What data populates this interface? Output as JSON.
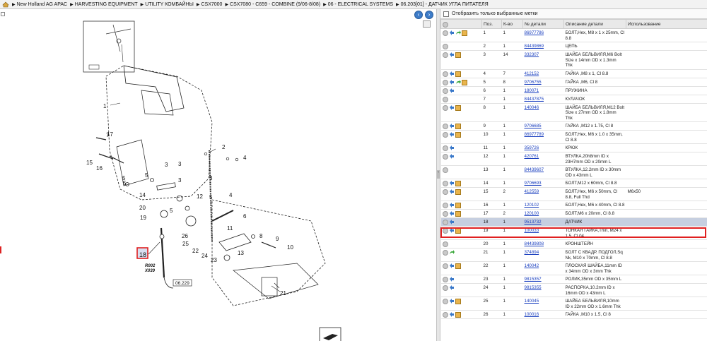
{
  "breadcrumb": [
    "New Holland AG APAC",
    "HARVESTING EQUIPMENT",
    "UTILITY КОМБАЙНЫ",
    "CSX7000",
    "CSX7080 - C659 - COMBINE (9/06-8/08)",
    "06 - ELECTRICAL SYSTEMS",
    "06.203[01] - ДАТЧИК УГЛА ПИТАТЕЛЯ"
  ],
  "filter": {
    "label": "Отобразить только выбранные метки"
  },
  "table": {
    "headers": [
      "Поз.",
      "К-во",
      "№ детали",
      "Описание детали",
      "Использование"
    ],
    "rows": [
      {
        "pos": "1",
        "qty": "1",
        "part": "86977786",
        "desc": "БОЛТ,Hex, M8 x 1 x 25mm, Cl 8.8",
        "usage": "",
        "icons": [
          "circle",
          "blue",
          "green",
          "box"
        ]
      },
      {
        "pos": "2",
        "qty": "1",
        "part": "84439869",
        "desc": "ЦЕПЬ",
        "usage": "",
        "icons": [
          "circle"
        ]
      },
      {
        "pos": "3",
        "qty": "14",
        "part": "332307",
        "desc": "ШАЙБА БЕЛЬВИЛЯ,M6 Bolt Size x 14mm OD x 1.3mm Thk",
        "usage": "",
        "icons": [
          "circle",
          "blue",
          "box"
        ]
      },
      {
        "pos": "4",
        "qty": "7",
        "part": "412152",
        "desc": "ГАЙКА ,M8 x 1, Cl 8.8",
        "usage": "",
        "icons": [
          "circle",
          "blue",
          "box"
        ]
      },
      {
        "pos": "5",
        "qty": "8",
        "part": "9706755",
        "desc": "ГАЙКА ,M6, Cl 8",
        "usage": "",
        "icons": [
          "circle",
          "blue",
          "green",
          "box"
        ]
      },
      {
        "pos": "6",
        "qty": "1",
        "part": "180071",
        "desc": "ПРУЖИНА",
        "usage": "",
        "icons": [
          "circle",
          "blue"
        ]
      },
      {
        "pos": "7",
        "qty": "1",
        "part": "84437875",
        "desc": "КУЛАЧОК",
        "usage": "",
        "icons": [
          "circle"
        ]
      },
      {
        "pos": "8",
        "qty": "1",
        "part": "140046",
        "desc": "ШАЙБА БЕЛЬВИЛЯ,M12 Bolt Size x 27mm OD x 1.8mm Thk",
        "usage": "",
        "icons": [
          "circle",
          "blue",
          "box"
        ]
      },
      {
        "pos": "9",
        "qty": "1",
        "part": "9706685",
        "desc": "ГАЙКА ,M12 x 1.75, Cl 8",
        "usage": "",
        "icons": [
          "circle",
          "blue",
          "box"
        ]
      },
      {
        "pos": "10",
        "qty": "1",
        "part": "86977789",
        "desc": "БОЛТ,Hex, M6 x 1.0 x 35mm, Cl 8.8",
        "usage": "",
        "icons": [
          "circle",
          "blue",
          "box"
        ]
      },
      {
        "pos": "11",
        "qty": "1",
        "part": "359726",
        "desc": "КРЮК",
        "usage": "",
        "icons": [
          "circle",
          "blue"
        ]
      },
      {
        "pos": "12",
        "qty": "1",
        "part": "420761",
        "desc": "ВТУЛКА,20h8mm ID x 23H7mm OD x 20mm L",
        "usage": "",
        "icons": [
          "circle",
          "blue"
        ]
      },
      {
        "pos": "13",
        "qty": "1",
        "part": "84439607",
        "desc": "ВТУЛКА,12.2mm ID x 30mm OD x 43mm L",
        "usage": "",
        "icons": [
          "circle"
        ]
      },
      {
        "pos": "14",
        "qty": "1",
        "part": "9706693",
        "desc": "БОЛТ,M12 x 60mm, Cl 8.8",
        "usage": "",
        "icons": [
          "circle",
          "blue",
          "box"
        ]
      },
      {
        "pos": "15",
        "qty": "2",
        "part": "412559",
        "desc": "БОЛТ,Hex, M6 x 50mm, Cl 8.8, Full Thd",
        "usage": "M6x50",
        "icons": [
          "circle",
          "blue",
          "box"
        ]
      },
      {
        "pos": "16",
        "qty": "1",
        "part": "120102",
        "desc": "БОЛТ,Hex, M6 x 40mm, Cl 8.8",
        "usage": "",
        "icons": [
          "circle",
          "blue",
          "box"
        ]
      },
      {
        "pos": "17",
        "qty": "2",
        "part": "120100",
        "desc": "БОЛТ,M6 x 20mm, Cl 8.8",
        "usage": "",
        "icons": [
          "circle",
          "blue",
          "box"
        ]
      },
      {
        "pos": "18",
        "qty": "1",
        "part": "9513732",
        "desc": "ДАТЧИК",
        "usage": "",
        "icons": [
          "circle",
          "blue"
        ],
        "selected": true
      },
      {
        "pos": "19",
        "qty": "1",
        "part": "100033",
        "desc": "ТОНКАЯ ГАЙКА,Thin, M24 x 1.5, Cl 04",
        "usage": "",
        "icons": [
          "circle",
          "blue",
          "box"
        ]
      },
      {
        "pos": "20",
        "qty": "1",
        "part": "84439808",
        "desc": "КРОНШТЕЙН",
        "usage": "",
        "icons": [
          "circle"
        ]
      },
      {
        "pos": "21",
        "qty": "1",
        "part": "374894",
        "desc": "БОЛТ С КВАДР. ПОДГОЛ,Sq Nk, M10 x 70mm, Cl 8.8",
        "usage": "",
        "icons": [
          "circle",
          "green"
        ]
      },
      {
        "pos": "22",
        "qty": "1",
        "part": "140042",
        "desc": "ПЛОСКАЯ ШАЙБА,11mm ID x 34mm OD x 3mm Thk",
        "usage": "",
        "icons": [
          "circle",
          "blue",
          "box"
        ]
      },
      {
        "pos": "23",
        "qty": "1",
        "part": "9815357",
        "desc": "РОЛИК,35mm OD x 35mm L",
        "usage": "",
        "icons": [
          "circle",
          "blue"
        ]
      },
      {
        "pos": "24",
        "qty": "1",
        "part": "9815355",
        "desc": "РАСПОРКА,10.2mm ID x 16mm OD x 43mm L",
        "usage": "",
        "icons": [
          "circle",
          "blue"
        ]
      },
      {
        "pos": "25",
        "qty": "1",
        "part": "140045",
        "desc": "ШАЙБА БЕЛЬВИЛЯ,10mm ID x 22mm OD x 1.6mm Thk",
        "usage": "",
        "icons": [
          "circle",
          "blue",
          "box"
        ]
      },
      {
        "pos": "26",
        "qty": "1",
        "part": "100016",
        "desc": "ГАЙКА ,M10 x 1.5, Cl 8",
        "usage": "",
        "icons": [
          "circle",
          "blue",
          "box"
        ]
      }
    ]
  },
  "drawing": {
    "callouts": [
      "1",
      "2",
      "3",
      "3",
      "3",
      "3",
      "4",
      "4",
      "5",
      "5",
      "5",
      "5",
      "5",
      "6",
      "7",
      "8",
      "9",
      "10",
      "11",
      "12",
      "13",
      "14",
      "15",
      "16",
      "17",
      "18",
      "19",
      "20",
      "21",
      "22",
      "23",
      "24",
      "25",
      "26"
    ],
    "highlighted_callout": "18",
    "sensor_labels": [
      "R002",
      "X039"
    ],
    "ref_label": "06.229"
  },
  "colors": {
    "highlight": "#e02020",
    "selected_row": "#c6cfe0",
    "link": "#1a3fbf",
    "nav_button": "#3d7cc9"
  }
}
